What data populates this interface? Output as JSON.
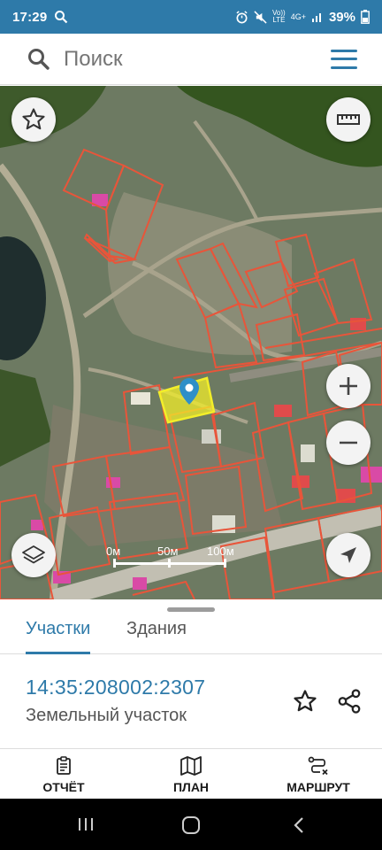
{
  "status": {
    "time": "17:29",
    "battery": "39%",
    "net_vol": "Vo))",
    "net_lte": "LTE",
    "net_4g": "4G+"
  },
  "search": {
    "placeholder": "Поиск"
  },
  "map": {
    "scale": {
      "label_0": "0м",
      "label_50": "50м",
      "label_100": "100м"
    }
  },
  "sheet": {
    "tabs": [
      {
        "label": "Участки",
        "active": true
      },
      {
        "label": "Здания",
        "active": false
      }
    ],
    "parcel": {
      "cadastral_number": "14:35:208002:2307",
      "type": "Земельный участок"
    }
  },
  "bottom_nav": {
    "report": "ОТЧЁТ",
    "plan": "ПЛАН",
    "route": "МАРШРУТ"
  },
  "colors": {
    "accent": "#2e7aa9",
    "parcel_outline": "#e8553a",
    "selected_fill": "#f2ee2a"
  }
}
